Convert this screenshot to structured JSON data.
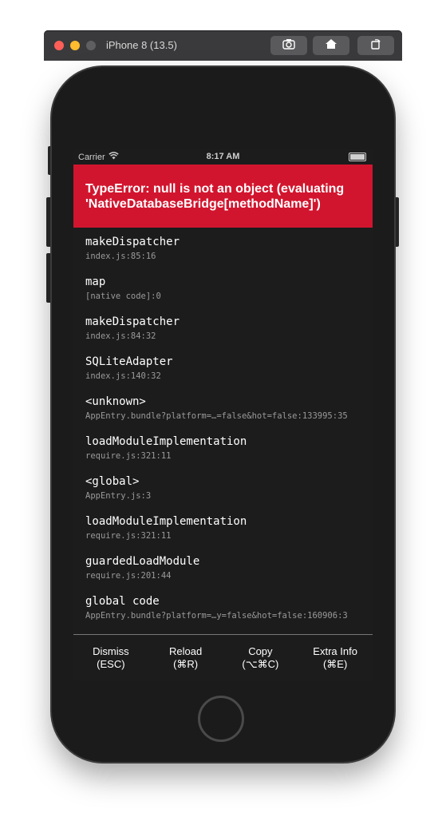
{
  "simulator": {
    "title": "iPhone 8 (13.5)",
    "buttons": [
      {
        "icon": "camera-icon"
      },
      {
        "icon": "home-icon"
      },
      {
        "icon": "rotate-icon"
      }
    ]
  },
  "statusbar": {
    "carrier": "Carrier",
    "time": "8:17 AM"
  },
  "error": {
    "message": "TypeError: null is not an object (evaluating 'NativeDatabaseBridge[methodName]')"
  },
  "stack": [
    {
      "fn": "makeDispatcher",
      "loc": "index.js:85:16"
    },
    {
      "fn": "map",
      "loc": "[native code]:0"
    },
    {
      "fn": "makeDispatcher",
      "loc": "index.js:84:32"
    },
    {
      "fn": "SQLiteAdapter",
      "loc": "index.js:140:32"
    },
    {
      "fn": "<unknown>",
      "loc": "AppEntry.bundle?platform=…=false&hot=false:133995:35"
    },
    {
      "fn": "loadModuleImplementation",
      "loc": "require.js:321:11"
    },
    {
      "fn": "<global>",
      "loc": "AppEntry.js:3"
    },
    {
      "fn": "loadModuleImplementation",
      "loc": "require.js:321:11"
    },
    {
      "fn": "guardedLoadModule",
      "loc": "require.js:201:44"
    },
    {
      "fn": "global code",
      "loc": "AppEntry.bundle?platform=…y=false&hot=false:160906:3"
    }
  ],
  "footer": {
    "dismiss": {
      "label": "Dismiss",
      "shortcut": "(ESC)"
    },
    "reload": {
      "label": "Reload",
      "shortcut": "(⌘R)"
    },
    "copy": {
      "label": "Copy",
      "shortcut": "(⌥⌘C)"
    },
    "extra": {
      "label": "Extra Info",
      "shortcut": "(⌘E)"
    }
  },
  "colors": {
    "error_banner": "#d2152e",
    "screen_bg": "#1c1c1c"
  }
}
